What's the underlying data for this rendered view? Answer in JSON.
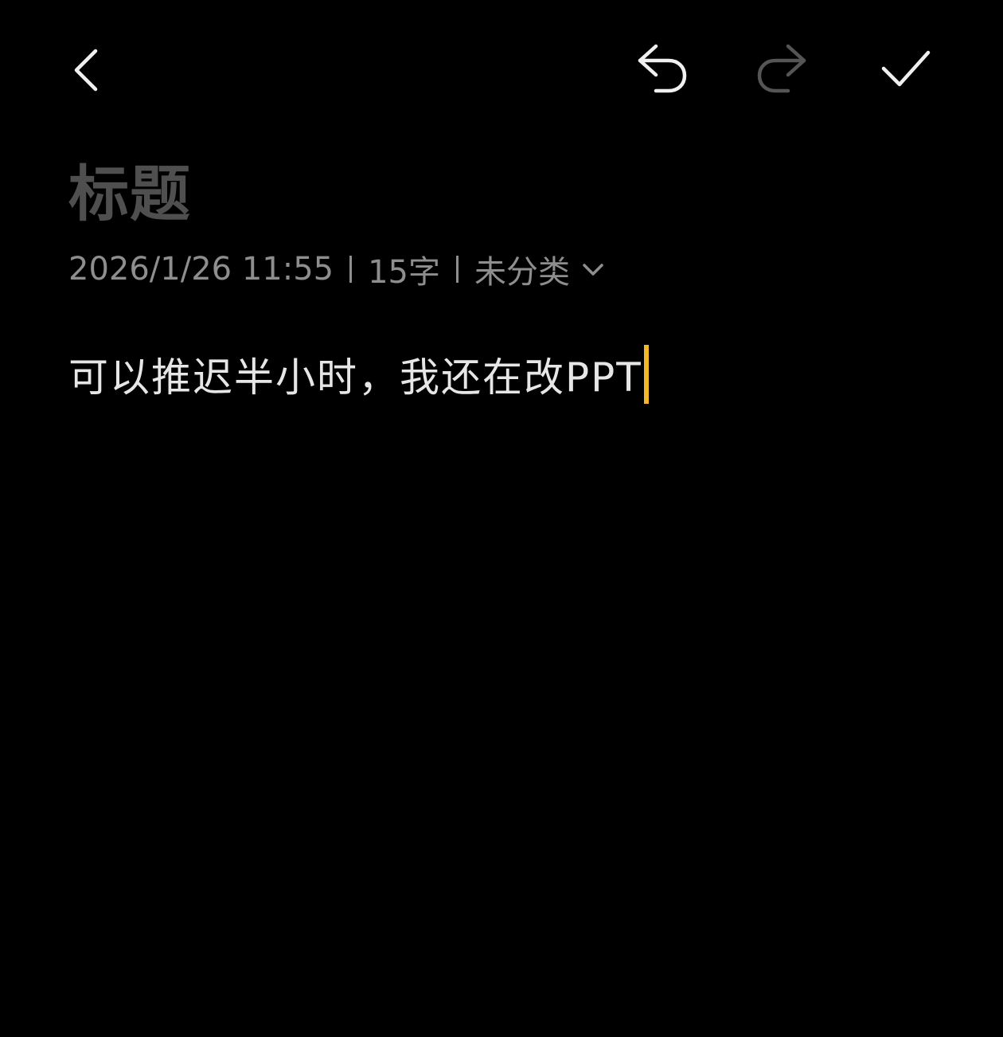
{
  "toolbar": {
    "back_icon": "chevron-left-icon",
    "undo_icon": "undo-icon",
    "redo_icon": "redo-icon",
    "redo_enabled": false,
    "done_icon": "checkmark-icon"
  },
  "note": {
    "title_placeholder": "标题",
    "datetime": "2026/1/26 11:55",
    "word_count": "15字",
    "category": "未分类",
    "category_icon": "chevron-down-icon",
    "content": "可以推迟半小时，我还在改PPT"
  },
  "colors": {
    "background": "#000000",
    "title_placeholder": "#4f4f4f",
    "meta_text": "#8e8e8e",
    "content_text": "#e6e6e6",
    "caret": "#f1b92a",
    "icon_active": "#f0f0f0",
    "icon_disabled": "#555555"
  }
}
